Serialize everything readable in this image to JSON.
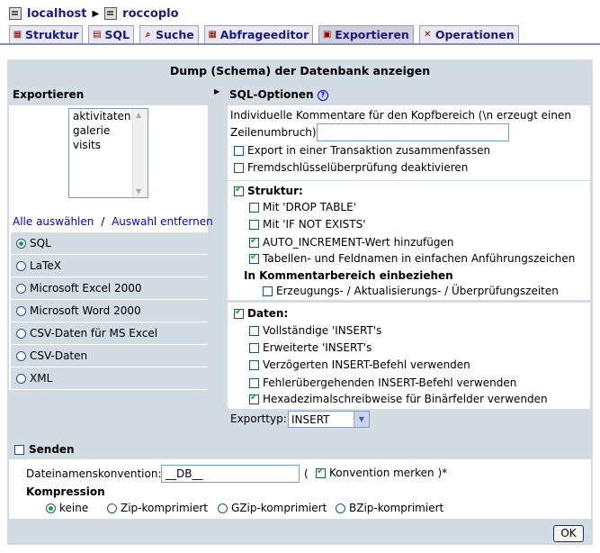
{
  "breadcrumb": {
    "server": "localhost",
    "database": "roccoplo"
  },
  "tabs": [
    {
      "label": "Struktur",
      "icon": "structure-icon"
    },
    {
      "label": "SQL",
      "icon": "sql-icon"
    },
    {
      "label": "Suche",
      "icon": "search-icon"
    },
    {
      "label": "Abfrageeditor",
      "icon": "query-icon"
    },
    {
      "label": "Exportieren",
      "icon": "export-icon"
    },
    {
      "label": "Operationen",
      "icon": "tools-icon"
    }
  ],
  "page_title": "Dump (Schema) der Datenbank anzeigen",
  "export": {
    "heading": "Exportieren",
    "tables": [
      "aktivitaten",
      "galerie",
      "visits"
    ],
    "select_all": "Alle auswählen",
    "divider": "/",
    "deselect_all": "Auswahl entfernen",
    "formats": [
      "SQL",
      "LaTeX",
      "Microsoft Excel 2000",
      "Microsoft Word 2000",
      "CSV-Daten für MS Excel",
      "CSV-Daten",
      "XML"
    ],
    "selected_format": "SQL"
  },
  "sql": {
    "heading": "SQL-Optionen",
    "comment_label_1": "Individuelle Kommentare für den Kopfbereich (\\n erzeugt einen",
    "comment_label_2": "Zeilenumbruch):",
    "comment_value": "",
    "transaction": "Export in einer Transaktion zusammenfassen",
    "fk_checks": "Fremdschlüsselüberprüfung deaktivieren"
  },
  "struktur": {
    "label": "Struktur:",
    "drop_table": "Mit 'DROP TABLE'",
    "if_not_exists": "Mit 'IF NOT EXISTS'",
    "auto_increment": "AUTO_INCREMENT-Wert hinzufügen",
    "backquotes": "Tabellen- und Feldnamen in einfachen Anführungszeichen",
    "comments_heading": "In Kommentarbereich einbeziehen",
    "dates": "Erzeugungs- / Aktualisierungs- / Überprüfungszeiten"
  },
  "daten": {
    "label": "Daten:",
    "complete_inserts": "Vollständige 'INSERT's",
    "extended_inserts": "Erweiterte 'INSERT's",
    "delayed": "Verzögerten INSERT-Befehl verwenden",
    "ignore": "Fehlerübergehenden INSERT-Befehl verwenden",
    "hex": "Hexadezimalschreibweise für Binärfelder verwenden",
    "export_type_label": "Exporttyp:",
    "export_type_value": "INSERT"
  },
  "senden": {
    "label": "Senden",
    "filename_label": "Dateinamenskonvention:",
    "filename_value": "__DB__",
    "paren_open": "(",
    "remember": "Konvention merken )*",
    "compression_label": "Kompression",
    "compression_options": [
      "keine",
      "Zip-komprimiert",
      "GZip-komprimiert",
      "BZip-komprimiert"
    ]
  },
  "ok_label": "OK",
  "colors": {
    "panel": "#d3dce3",
    "link": "#0000cc",
    "tab_text": "#1a1a80",
    "check": "#21a121"
  }
}
